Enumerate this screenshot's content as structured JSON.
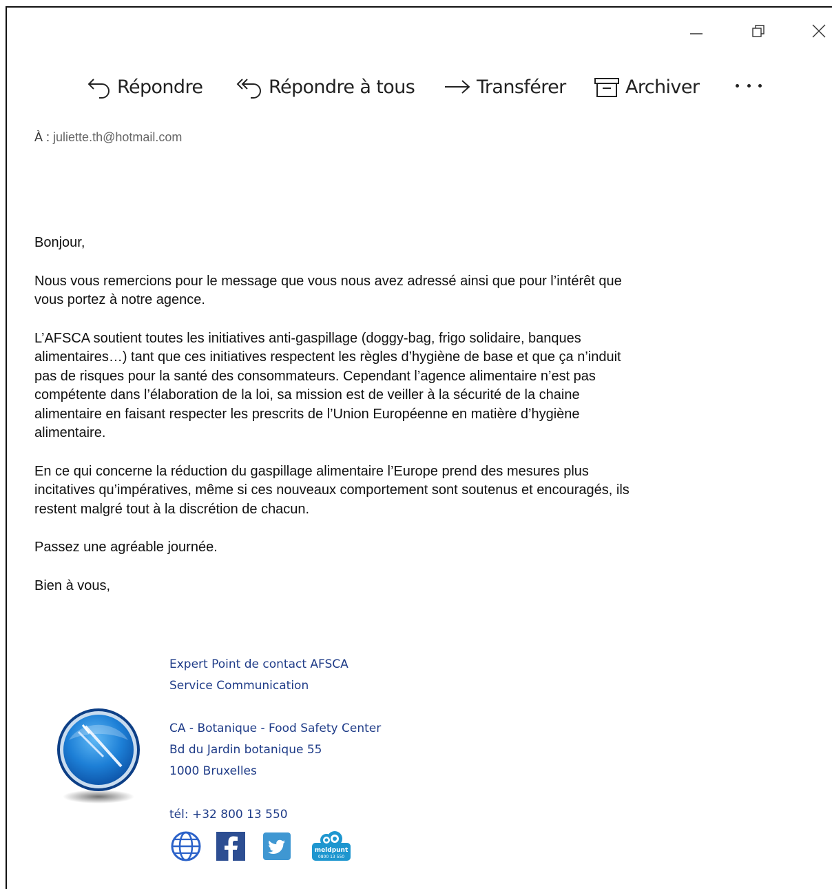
{
  "window": {
    "controls": [
      "minimize-icon",
      "restore-icon",
      "close-icon"
    ]
  },
  "toolbar": {
    "reply": "Répondre",
    "reply_all": "Répondre à tous",
    "forward": "Transférer",
    "archive": "Archiver"
  },
  "header": {
    "to_label": "À :",
    "to_value": "juliette.th@hotmail.com"
  },
  "message": {
    "greeting": "Bonjour,",
    "p1": "Nous vous remercions pour le message que vous nous avez adressé ainsi que pour l’intérêt que vous portez à notre agence.",
    "p2": "L’AFSCA soutient toutes les initiatives anti-gaspillage (doggy-bag, frigo solidaire, banques alimentaires…) tant que ces initiatives respectent les règles d’hygiène de base et que ça n’induit pas de risques pour la santé des consommateurs. Cependant l’agence alimentaire n’est pas compétente dans l’élaboration de la loi, sa mission est de veiller à la sécurité de la chaine alimentaire en faisant respecter les prescrits de l’Union Européenne en matière d’hygiène alimentaire.",
    "p3": "En ce qui concerne la réduction du gaspillage alimentaire l’Europe prend des mesures plus incitatives qu’impératives, même si ces nouveaux comportement sont soutenus et encouragés, ils restent malgré tout à la discrétion de chacun.",
    "p4": "Passez une agréable journée.",
    "closing": "Bien à vous,"
  },
  "signature": {
    "line1": "Expert Point de contact AFSCA",
    "line2": "Service Communication",
    "line3": "CA - Botanique - Food Safety Center",
    "line4": "Bd du Jardin botanique 55",
    "line5": "1000 Bruxelles",
    "phone": "tél:  +32 800 13 550",
    "social": [
      "globe-icon",
      "facebook-icon",
      "twitter-icon",
      "meldpunt-icon"
    ],
    "meldpunt_text": "meldpunt",
    "meldpunt_number": "0800 13 550"
  },
  "colors": {
    "signature_blue": "#1f3c88",
    "facebook": "#2d4e92",
    "twitter": "#3f97d2",
    "globe": "#2b62c9",
    "meldpunt": "#1e96cf"
  }
}
